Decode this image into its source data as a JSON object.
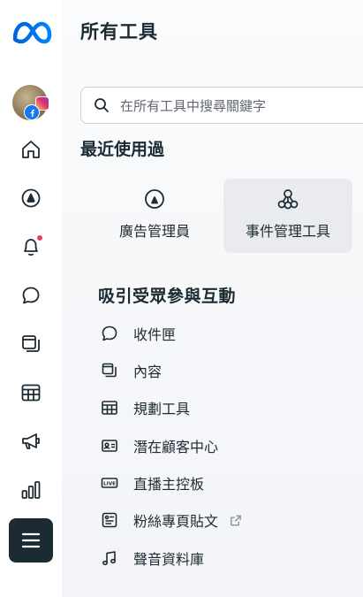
{
  "rail": {
    "items": [
      {
        "name": "home",
        "icon": "home-icon"
      },
      {
        "name": "ads-manager",
        "icon": "ads-manager-icon"
      },
      {
        "name": "notifications",
        "icon": "bell-icon",
        "has_alert": true
      },
      {
        "name": "inbox",
        "icon": "chat-bubble-icon"
      },
      {
        "name": "content",
        "icon": "content-icon"
      },
      {
        "name": "planner",
        "icon": "calendar-grid-icon"
      },
      {
        "name": "ads",
        "icon": "megaphone-icon"
      },
      {
        "name": "insights",
        "icon": "bar-chart-icon"
      }
    ],
    "menu_icon": "hamburger-icon",
    "accent": "#1877f2",
    "alert_color": "#e4405f"
  },
  "page": {
    "title": "所有工具"
  },
  "search": {
    "placeholder": "在所有工具中搜尋關鍵字",
    "value": ""
  },
  "recent": {
    "title": "最近使用過",
    "items": [
      {
        "label": "廣告管理員",
        "icon": "ads-manager-icon"
      },
      {
        "label": "事件管理工具",
        "icon": "events-manager-icon",
        "highlighted": true
      }
    ]
  },
  "engage": {
    "title": "吸引受眾參與互動",
    "tools": [
      {
        "label": "收件匣",
        "icon": "chat-bubble-icon"
      },
      {
        "label": "內容",
        "icon": "content-icon"
      },
      {
        "label": "規劃工具",
        "icon": "calendar-grid-icon"
      },
      {
        "label": "潛在顧客中心",
        "icon": "contact-card-icon"
      },
      {
        "label": "直播主控板",
        "icon": "live-icon"
      },
      {
        "label": "粉絲專頁貼文",
        "icon": "page-post-icon",
        "external": true
      },
      {
        "label": "聲音資料庫",
        "icon": "music-note-icon"
      }
    ]
  }
}
